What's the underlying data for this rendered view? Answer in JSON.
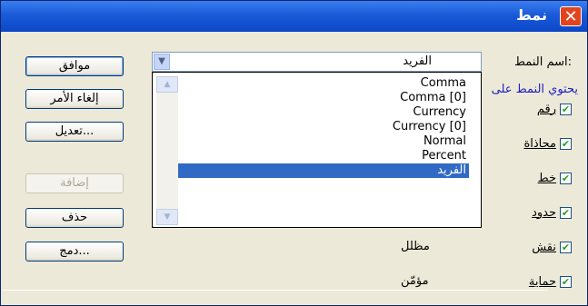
{
  "window": {
    "title": "نمط",
    "close": "✕"
  },
  "buttons": {
    "ok": "موافق",
    "cancel": "إلغاء الأمر",
    "modify": "تعديل...",
    "add": "إضافة",
    "delete": "حذف",
    "merge": "دمج..."
  },
  "style_name": {
    "label": "اسم النمط:",
    "value": "الفريد"
  },
  "includes_label": "يحتوي النمط على",
  "dropdown": {
    "items": [
      "Comma",
      "Comma [0]",
      "Currency",
      "Currency [0]",
      "Normal",
      "Percent",
      "الفريد"
    ],
    "selected_index": 6
  },
  "checkboxes": [
    {
      "label": "رقم",
      "checked": true
    },
    {
      "label": "محاذاة",
      "checked": true
    },
    {
      "label": "خط",
      "checked": true
    },
    {
      "label": "حدود",
      "checked": true
    },
    {
      "label": "نقش",
      "checked": true,
      "detail": "مظلل"
    },
    {
      "label": "حماية",
      "checked": true,
      "detail": "مؤمّن"
    }
  ],
  "colors": {
    "titlebar": "#0c47c8",
    "selection": "#316ac5",
    "includes_label": "#2020c0",
    "check": "#21a121"
  },
  "icons": {
    "close": "close-icon",
    "dropdown_arrow": "chevron-down-icon",
    "scroll_up": "scroll-up-icon",
    "scroll_down": "scroll-down-icon",
    "check": "checkmark-icon"
  }
}
